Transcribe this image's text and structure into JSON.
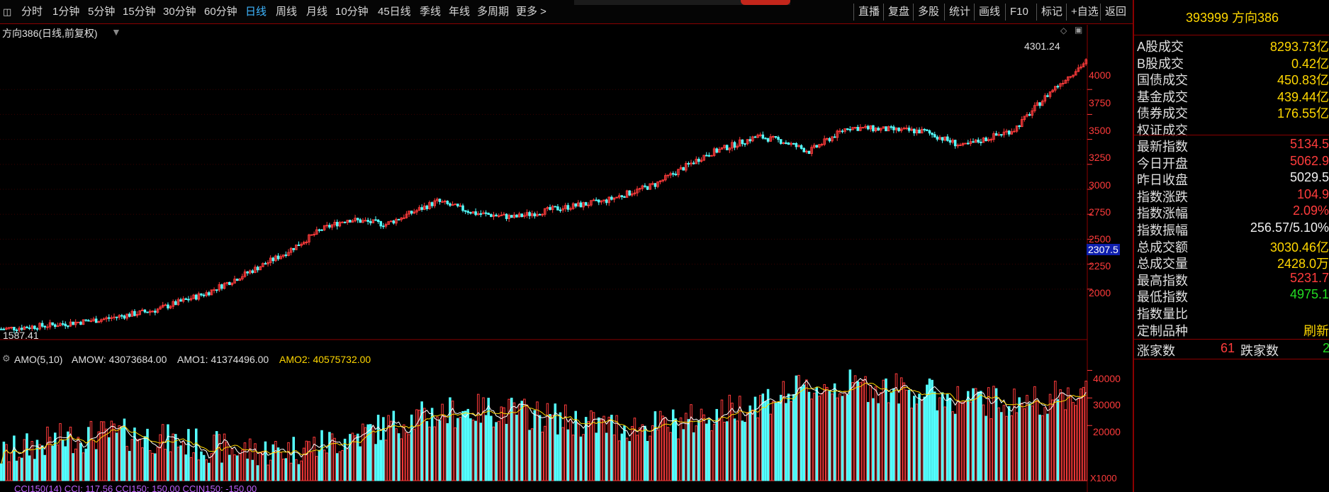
{
  "toolbar": {
    "periods": [
      "分时",
      "1分钟",
      "5分钟",
      "15分钟",
      "30分钟",
      "60分钟",
      "日线",
      "周线",
      "月线",
      "10分钟",
      "45日线",
      "季线",
      "年线",
      "多周期",
      "更多 >"
    ],
    "active_period": "日线",
    "right_buttons": [
      "直播",
      "复盘",
      "多股",
      "统计",
      "画线",
      "F10",
      "标记",
      "+自选",
      "返回"
    ]
  },
  "main_chart": {
    "title": "方向386(日线,前复权)",
    "high_label": "4301.24",
    "low_label": "1587.41",
    "current_price_tag": "2307.5",
    "y_ticks": [
      {
        "label": "4000",
        "value": 4000
      },
      {
        "label": "3750",
        "value": 3750
      },
      {
        "label": "3500",
        "value": 3500
      },
      {
        "label": "3250",
        "value": 3250
      },
      {
        "label": "3000",
        "value": 3000
      },
      {
        "label": "2750",
        "value": 2750
      },
      {
        "label": "2500",
        "value": 2500
      },
      {
        "label": "2250",
        "value": 2250
      },
      {
        "label": "2000",
        "value": 2000
      }
    ]
  },
  "amo_panel": {
    "name": "AMO(5,10)",
    "amow": "AMOW: 43073684.00",
    "amo1": "AMO1: 41374496.00",
    "amo2": "AMO2: 40575732.00",
    "y_ticks": [
      {
        "label": "40000",
        "value": 40000
      },
      {
        "label": "30000",
        "value": 30000
      },
      {
        "label": "20000",
        "value": 20000
      }
    ],
    "unit": "X1000"
  },
  "cci_panel": {
    "text": "CCI150(14)   CCI: 117.56   CCI150: 150.00   CCIN150: -150.00"
  },
  "side_panel": {
    "title": "393999 方向386",
    "volume_rows": [
      {
        "label": "A股成交",
        "value": "8293.73亿"
      },
      {
        "label": "B股成交",
        "value": "0.42亿"
      },
      {
        "label": "国债成交",
        "value": "450.83亿"
      },
      {
        "label": "基金成交",
        "value": "439.44亿"
      },
      {
        "label": "债券成交",
        "value": "176.55亿"
      },
      {
        "label": "权证成交",
        "value": ""
      }
    ],
    "index_rows": [
      {
        "label": "最新指数",
        "value": "5134.5",
        "color": "#ff3c3c"
      },
      {
        "label": "今日开盘",
        "value": "5062.9",
        "color": "#ff3c3c"
      },
      {
        "label": "昨日收盘",
        "value": "5029.5",
        "color": "#f0f0f0"
      },
      {
        "label": "指数涨跌",
        "value": "104.9",
        "color": "#ff3c3c"
      },
      {
        "label": "指数涨幅",
        "value": "2.09%",
        "color": "#ff3c3c"
      },
      {
        "label": "指数振幅",
        "value": "256.57/5.10%",
        "color": "#f0f0f0"
      },
      {
        "label": "总成交额",
        "value": "3030.46亿",
        "color": "#ffd700"
      },
      {
        "label": "总成交量",
        "value": "2428.0万",
        "color": "#ffd700"
      },
      {
        "label": "最高指数",
        "value": "5231.7",
        "color": "#ff3c3c"
      },
      {
        "label": "最低指数",
        "value": "4975.1",
        "color": "#22dd22"
      },
      {
        "label": "指数量比",
        "value": "",
        "color": "#ffd700"
      },
      {
        "label": "定制品种",
        "value": "刷新",
        "color": "#ffd700"
      }
    ],
    "breadth": {
      "up_label": "涨家数",
      "up_value": "61",
      "down_label": "跌家数",
      "down_value": "2"
    }
  },
  "colors": {
    "up": "#ff3b3b",
    "down": "#54ffff",
    "border": "#8a0000",
    "amo1": "#ffffff",
    "amo2": "#ffd700",
    "ticks": "#ff3b3b"
  }
}
